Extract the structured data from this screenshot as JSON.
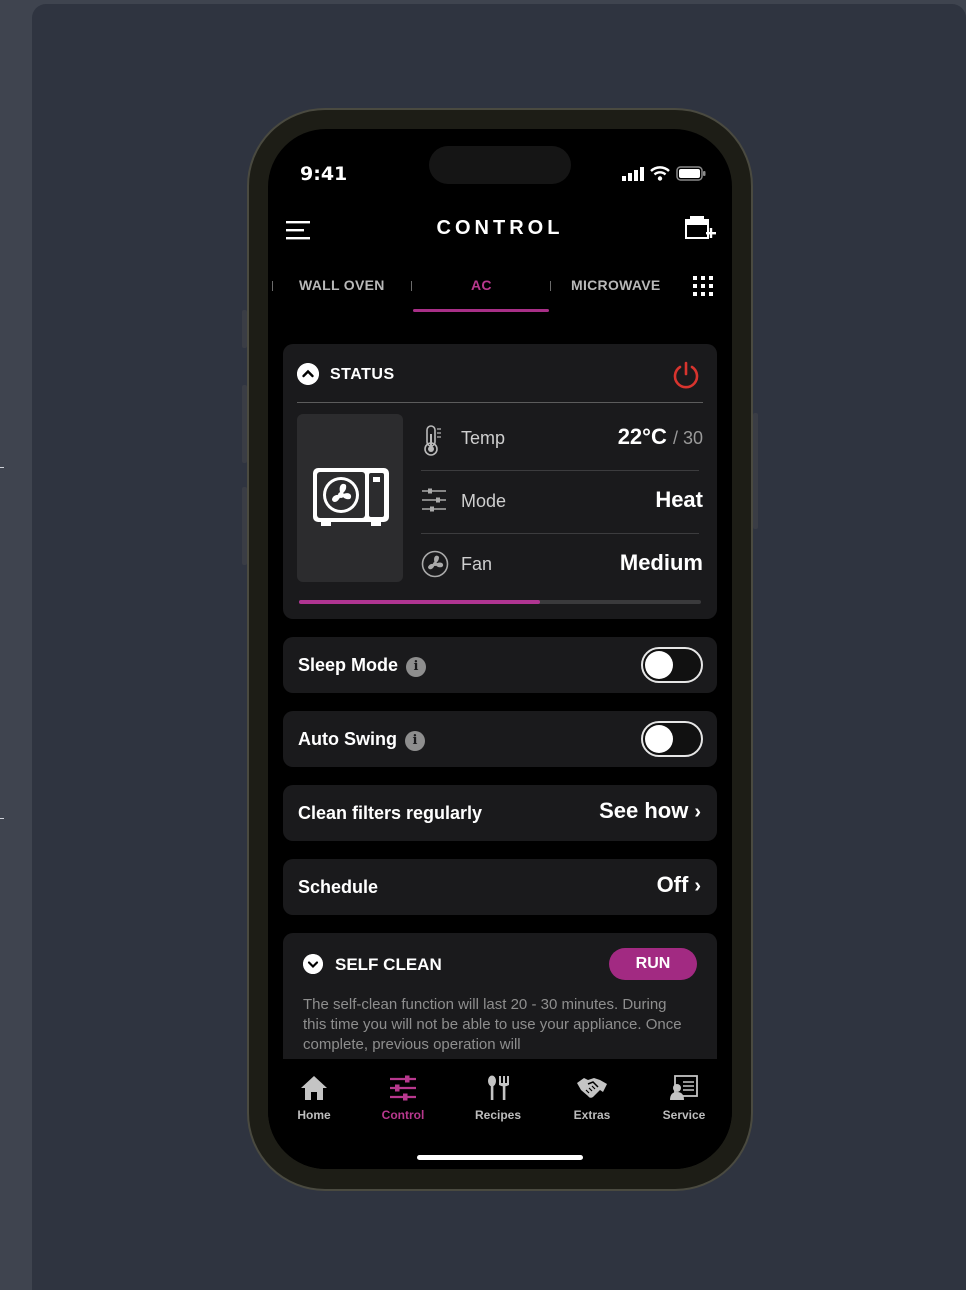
{
  "status_bar": {
    "time": "9:41"
  },
  "header": {
    "title": "CONTROL"
  },
  "tabs": [
    {
      "label": "WALL OVEN",
      "active": false
    },
    {
      "label": "AC",
      "active": true
    },
    {
      "label": "MICROWAVE",
      "active": false
    }
  ],
  "status": {
    "heading": "STATUS",
    "temp": {
      "label": "Temp",
      "value": "22°C",
      "sub": "/ 30"
    },
    "mode": {
      "label": "Mode",
      "value": "Heat"
    },
    "fan": {
      "label": "Fan",
      "value": "Medium"
    },
    "progress": 0.6,
    "colors": {
      "power": "#d8342e",
      "accent": "#a82f87"
    }
  },
  "sleep_mode": {
    "label": "Sleep Mode",
    "enabled": false
  },
  "auto_swing": {
    "label": "Auto Swing",
    "enabled": false
  },
  "clean_filters": {
    "label": "Clean filters regularly",
    "link": "See how"
  },
  "schedule": {
    "label": "Schedule",
    "value": "Off"
  },
  "self_clean": {
    "heading": "SELF CLEAN",
    "button": "RUN",
    "text": "The self-clean function will last 20 - 30 minutes. During this time you will not be able to use your appliance. Once complete, previous operation will"
  },
  "bottom_nav": [
    {
      "label": "Home",
      "icon": "home-icon",
      "active": false
    },
    {
      "label": "Control",
      "icon": "sliders-icon",
      "active": true
    },
    {
      "label": "Recipes",
      "icon": "cutlery-icon",
      "active": false
    },
    {
      "label": "Extras",
      "icon": "handshake-icon",
      "active": false
    },
    {
      "label": "Service",
      "icon": "service-icon",
      "active": false
    }
  ]
}
